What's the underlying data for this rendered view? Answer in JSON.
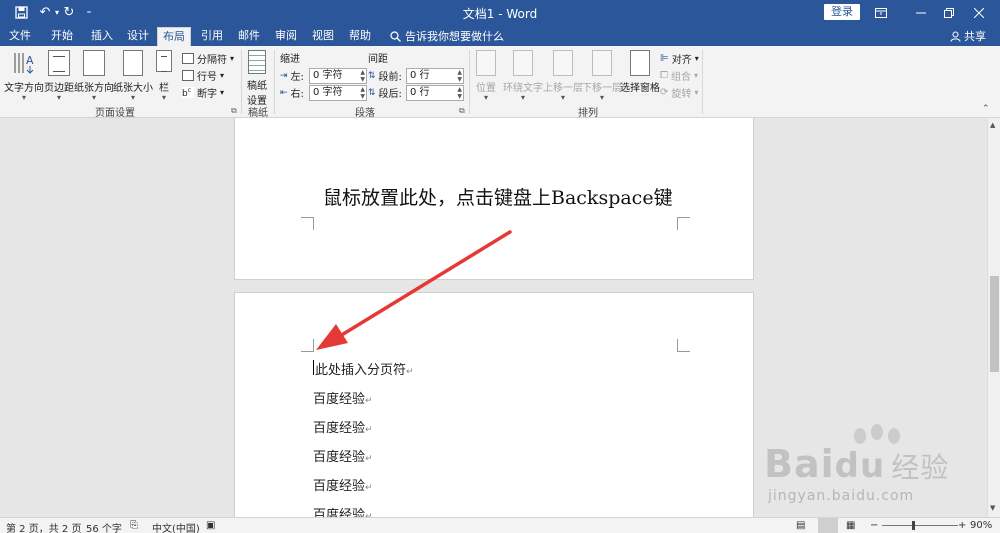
{
  "titlebar": {
    "doc_title": "文档1 - Word",
    "login_label": "登录",
    "colors": {
      "bg": "#2b579a"
    }
  },
  "tabs": [
    {
      "label": "文件"
    },
    {
      "label": "开始"
    },
    {
      "label": "插入"
    },
    {
      "label": "设计"
    },
    {
      "label": "布局",
      "active": true
    },
    {
      "label": "引用"
    },
    {
      "label": "邮件"
    },
    {
      "label": "审阅"
    },
    {
      "label": "视图"
    },
    {
      "label": "帮助"
    }
  ],
  "tell_me": "告诉我你想要做什么",
  "share_label": "共享",
  "ribbon": {
    "page_setup": {
      "label": "页面设置",
      "text_direction": "文字方向",
      "margins": "页边距",
      "orientation": "纸张方向",
      "size": "纸张大小",
      "columns": "栏",
      "breaks": "分隔符",
      "line_numbers": "行号",
      "hyphenation": "断字"
    },
    "draft": {
      "label": "稿纸",
      "draft_setup_line1": "稿纸",
      "draft_setup_line2": "设置"
    },
    "paragraph": {
      "label": "段落",
      "indent_title": "缩进",
      "spacing_title": "间距",
      "left_label": "左:",
      "right_label": "右:",
      "before_label": "段前:",
      "after_label": "段后:",
      "left_value": "0 字符",
      "right_value": "0 字符",
      "before_value": "0 行",
      "after_value": "0 行"
    },
    "arrange": {
      "label": "排列",
      "position": "位置",
      "wrap_text": "环绕文字",
      "bring_forward": "上移一层",
      "send_backward": "下移一层",
      "selection_pane": "选择窗格",
      "align": "对齐",
      "group": "组合",
      "rotate": "旋转"
    }
  },
  "document": {
    "page1_text": "鼠标放置此处，点击键盘上Backspace键",
    "page2_first_line": "此处插入分页符",
    "lines": [
      "百度经验",
      "百度经验",
      "百度经验",
      "百度经验",
      "百度经验"
    ],
    "paragraph_mark": "↵"
  },
  "status": {
    "page_info": "第 2 页，共 2 页",
    "word_count": "56 个字",
    "language": "中文(中国)",
    "zoom": "90%",
    "zoom_fraction": 0.9
  },
  "watermark": {
    "brand": "Bai",
    "brand_suffix": "经验",
    "url": "jingyan.baidu.com"
  },
  "annotation_color": "#e53935"
}
